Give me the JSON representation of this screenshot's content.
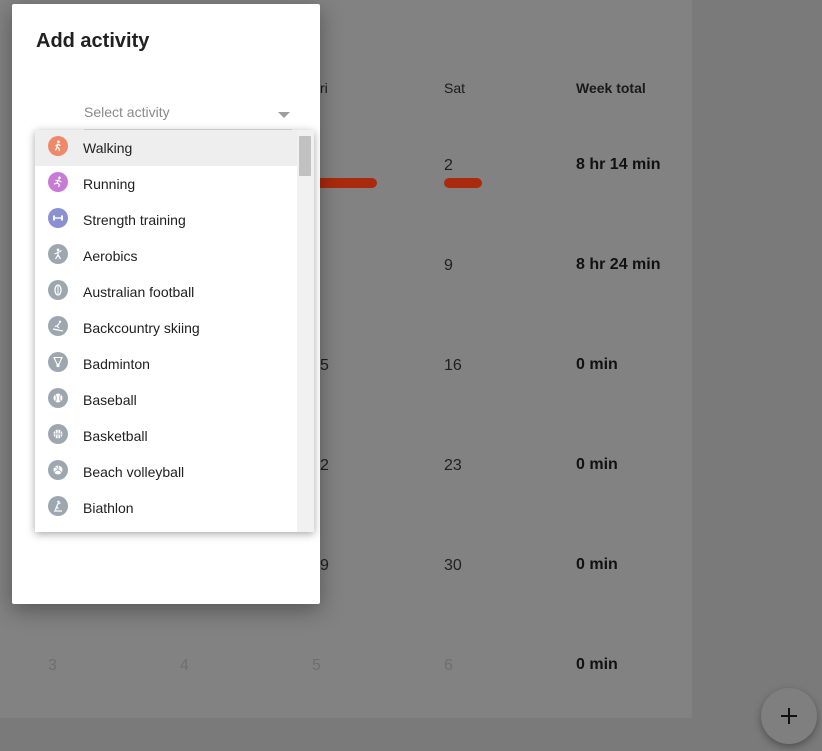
{
  "dialog": {
    "title": "Add activity",
    "select_placeholder": "Select activity",
    "activities": [
      {
        "label": "Walking",
        "color": "#ee8a6a",
        "icon": "walking-icon"
      },
      {
        "label": "Running",
        "color": "#c77ad6",
        "icon": "running-icon"
      },
      {
        "label": "Strength training",
        "color": "#8a90d0",
        "icon": "dumbbell-icon"
      },
      {
        "label": "Aerobics",
        "color": "#9ea7b0",
        "icon": "aerobics-icon"
      },
      {
        "label": "Australian football",
        "color": "#9ea7b0",
        "icon": "football-icon"
      },
      {
        "label": "Backcountry skiing",
        "color": "#9ea7b0",
        "icon": "skiing-icon"
      },
      {
        "label": "Badminton",
        "color": "#9ea7b0",
        "icon": "shuttlecock-icon"
      },
      {
        "label": "Baseball",
        "color": "#9ea7b0",
        "icon": "baseball-icon"
      },
      {
        "label": "Basketball",
        "color": "#9ea7b0",
        "icon": "basketball-icon"
      },
      {
        "label": "Beach volleyball",
        "color": "#9ea7b0",
        "icon": "volleyball-icon"
      },
      {
        "label": "Biathlon",
        "color": "#9ea7b0",
        "icon": "biathlon-icon"
      }
    ],
    "highlighted_index": 0
  },
  "calendar": {
    "headers": {
      "fri_partial": "ri",
      "sat": "Sat",
      "week_total": "Week total"
    },
    "rows": [
      {
        "fri": "",
        "sat": "2",
        "total": "8 hr 14 min"
      },
      {
        "fri": "",
        "sat": "9",
        "total": "8 hr 24 min"
      },
      {
        "fri": "5",
        "sat": "16",
        "total": "0 min"
      },
      {
        "fri": "2",
        "sat": "23",
        "total": "0 min"
      },
      {
        "fri": "9",
        "sat": "30",
        "total": "0 min"
      }
    ],
    "last_row": {
      "days": [
        "3",
        "4",
        "5",
        "6"
      ],
      "total": "0 min"
    },
    "bar_color": "#aa2a0e"
  },
  "fab": {
    "icon": "plus-icon"
  }
}
